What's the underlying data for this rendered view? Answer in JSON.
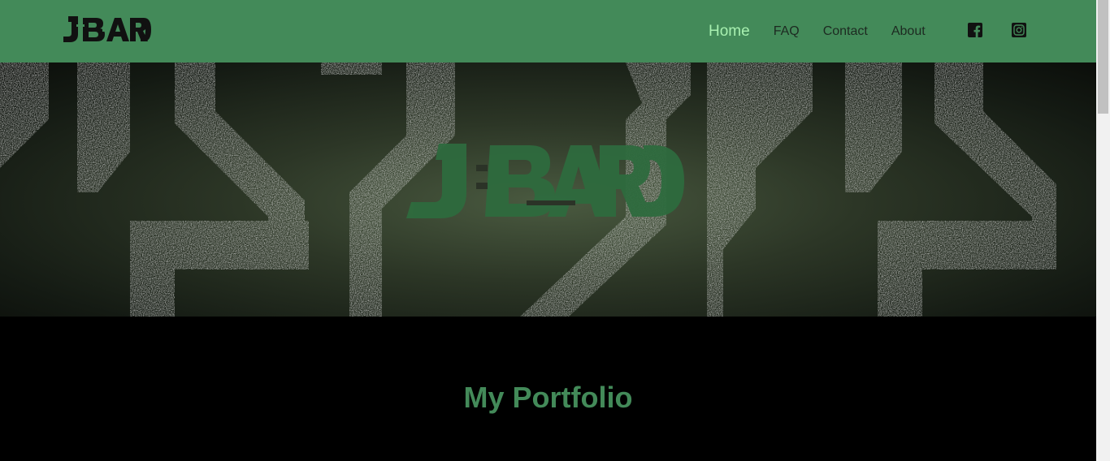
{
  "header": {
    "logo_text": "JBARD",
    "nav": [
      {
        "label": "Home",
        "active": true
      },
      {
        "label": "FAQ",
        "active": false
      },
      {
        "label": "Contact",
        "active": false
      },
      {
        "label": "About",
        "active": false
      }
    ],
    "social": [
      {
        "icon": "facebook-icon"
      },
      {
        "icon": "instagram-icon"
      }
    ]
  },
  "hero": {
    "logo_text": "JBARD"
  },
  "main": {
    "title": "My Portfolio"
  },
  "colors": {
    "brand_green": "#438a59",
    "nav_active": "#a8f0b0",
    "nav_text": "#1d2a21",
    "background": "#000000"
  }
}
